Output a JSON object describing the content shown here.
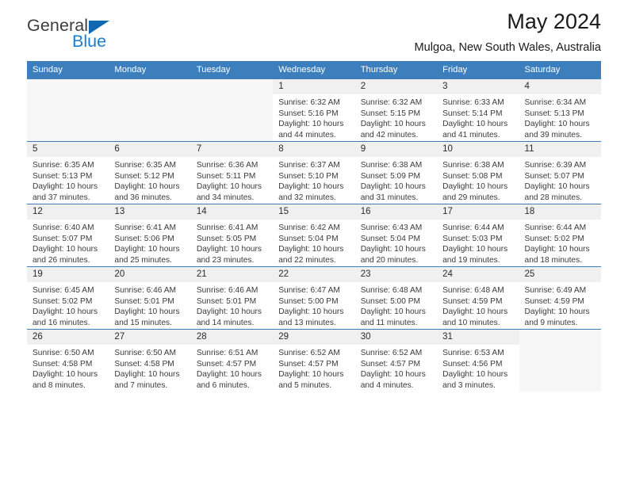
{
  "brand": {
    "name_part1": "General",
    "name_part2": "Blue",
    "triangle_color": "#1068b3",
    "blue_text_color": "#1b7dd1"
  },
  "header": {
    "title": "May 2024",
    "subtitle": "Mulgoa, New South Wales, Australia"
  },
  "theme": {
    "header_bg": "#3d7ebd",
    "header_text": "#ffffff",
    "daynum_bg": "#f0f0f0",
    "empty_cell_bg": "#f7f7f7"
  },
  "weekday_headers": [
    "Sunday",
    "Monday",
    "Tuesday",
    "Wednesday",
    "Thursday",
    "Friday",
    "Saturday"
  ],
  "weeks": [
    [
      {
        "empty": true
      },
      {
        "empty": true
      },
      {
        "empty": true
      },
      {
        "day": "1",
        "sunrise": "Sunrise: 6:32 AM",
        "sunset": "Sunset: 5:16 PM",
        "daylight1": "Daylight: 10 hours",
        "daylight2": "and 44 minutes."
      },
      {
        "day": "2",
        "sunrise": "Sunrise: 6:32 AM",
        "sunset": "Sunset: 5:15 PM",
        "daylight1": "Daylight: 10 hours",
        "daylight2": "and 42 minutes."
      },
      {
        "day": "3",
        "sunrise": "Sunrise: 6:33 AM",
        "sunset": "Sunset: 5:14 PM",
        "daylight1": "Daylight: 10 hours",
        "daylight2": "and 41 minutes."
      },
      {
        "day": "4",
        "sunrise": "Sunrise: 6:34 AM",
        "sunset": "Sunset: 5:13 PM",
        "daylight1": "Daylight: 10 hours",
        "daylight2": "and 39 minutes."
      }
    ],
    [
      {
        "day": "5",
        "sunrise": "Sunrise: 6:35 AM",
        "sunset": "Sunset: 5:13 PM",
        "daylight1": "Daylight: 10 hours",
        "daylight2": "and 37 minutes."
      },
      {
        "day": "6",
        "sunrise": "Sunrise: 6:35 AM",
        "sunset": "Sunset: 5:12 PM",
        "daylight1": "Daylight: 10 hours",
        "daylight2": "and 36 minutes."
      },
      {
        "day": "7",
        "sunrise": "Sunrise: 6:36 AM",
        "sunset": "Sunset: 5:11 PM",
        "daylight1": "Daylight: 10 hours",
        "daylight2": "and 34 minutes."
      },
      {
        "day": "8",
        "sunrise": "Sunrise: 6:37 AM",
        "sunset": "Sunset: 5:10 PM",
        "daylight1": "Daylight: 10 hours",
        "daylight2": "and 32 minutes."
      },
      {
        "day": "9",
        "sunrise": "Sunrise: 6:38 AM",
        "sunset": "Sunset: 5:09 PM",
        "daylight1": "Daylight: 10 hours",
        "daylight2": "and 31 minutes."
      },
      {
        "day": "10",
        "sunrise": "Sunrise: 6:38 AM",
        "sunset": "Sunset: 5:08 PM",
        "daylight1": "Daylight: 10 hours",
        "daylight2": "and 29 minutes."
      },
      {
        "day": "11",
        "sunrise": "Sunrise: 6:39 AM",
        "sunset": "Sunset: 5:07 PM",
        "daylight1": "Daylight: 10 hours",
        "daylight2": "and 28 minutes."
      }
    ],
    [
      {
        "day": "12",
        "sunrise": "Sunrise: 6:40 AM",
        "sunset": "Sunset: 5:07 PM",
        "daylight1": "Daylight: 10 hours",
        "daylight2": "and 26 minutes."
      },
      {
        "day": "13",
        "sunrise": "Sunrise: 6:41 AM",
        "sunset": "Sunset: 5:06 PM",
        "daylight1": "Daylight: 10 hours",
        "daylight2": "and 25 minutes."
      },
      {
        "day": "14",
        "sunrise": "Sunrise: 6:41 AM",
        "sunset": "Sunset: 5:05 PM",
        "daylight1": "Daylight: 10 hours",
        "daylight2": "and 23 minutes."
      },
      {
        "day": "15",
        "sunrise": "Sunrise: 6:42 AM",
        "sunset": "Sunset: 5:04 PM",
        "daylight1": "Daylight: 10 hours",
        "daylight2": "and 22 minutes."
      },
      {
        "day": "16",
        "sunrise": "Sunrise: 6:43 AM",
        "sunset": "Sunset: 5:04 PM",
        "daylight1": "Daylight: 10 hours",
        "daylight2": "and 20 minutes."
      },
      {
        "day": "17",
        "sunrise": "Sunrise: 6:44 AM",
        "sunset": "Sunset: 5:03 PM",
        "daylight1": "Daylight: 10 hours",
        "daylight2": "and 19 minutes."
      },
      {
        "day": "18",
        "sunrise": "Sunrise: 6:44 AM",
        "sunset": "Sunset: 5:02 PM",
        "daylight1": "Daylight: 10 hours",
        "daylight2": "and 18 minutes."
      }
    ],
    [
      {
        "day": "19",
        "sunrise": "Sunrise: 6:45 AM",
        "sunset": "Sunset: 5:02 PM",
        "daylight1": "Daylight: 10 hours",
        "daylight2": "and 16 minutes."
      },
      {
        "day": "20",
        "sunrise": "Sunrise: 6:46 AM",
        "sunset": "Sunset: 5:01 PM",
        "daylight1": "Daylight: 10 hours",
        "daylight2": "and 15 minutes."
      },
      {
        "day": "21",
        "sunrise": "Sunrise: 6:46 AM",
        "sunset": "Sunset: 5:01 PM",
        "daylight1": "Daylight: 10 hours",
        "daylight2": "and 14 minutes."
      },
      {
        "day": "22",
        "sunrise": "Sunrise: 6:47 AM",
        "sunset": "Sunset: 5:00 PM",
        "daylight1": "Daylight: 10 hours",
        "daylight2": "and 13 minutes."
      },
      {
        "day": "23",
        "sunrise": "Sunrise: 6:48 AM",
        "sunset": "Sunset: 5:00 PM",
        "daylight1": "Daylight: 10 hours",
        "daylight2": "and 11 minutes."
      },
      {
        "day": "24",
        "sunrise": "Sunrise: 6:48 AM",
        "sunset": "Sunset: 4:59 PM",
        "daylight1": "Daylight: 10 hours",
        "daylight2": "and 10 minutes."
      },
      {
        "day": "25",
        "sunrise": "Sunrise: 6:49 AM",
        "sunset": "Sunset: 4:59 PM",
        "daylight1": "Daylight: 10 hours",
        "daylight2": "and 9 minutes."
      }
    ],
    [
      {
        "day": "26",
        "sunrise": "Sunrise: 6:50 AM",
        "sunset": "Sunset: 4:58 PM",
        "daylight1": "Daylight: 10 hours",
        "daylight2": "and 8 minutes."
      },
      {
        "day": "27",
        "sunrise": "Sunrise: 6:50 AM",
        "sunset": "Sunset: 4:58 PM",
        "daylight1": "Daylight: 10 hours",
        "daylight2": "and 7 minutes."
      },
      {
        "day": "28",
        "sunrise": "Sunrise: 6:51 AM",
        "sunset": "Sunset: 4:57 PM",
        "daylight1": "Daylight: 10 hours",
        "daylight2": "and 6 minutes."
      },
      {
        "day": "29",
        "sunrise": "Sunrise: 6:52 AM",
        "sunset": "Sunset: 4:57 PM",
        "daylight1": "Daylight: 10 hours",
        "daylight2": "and 5 minutes."
      },
      {
        "day": "30",
        "sunrise": "Sunrise: 6:52 AM",
        "sunset": "Sunset: 4:57 PM",
        "daylight1": "Daylight: 10 hours",
        "daylight2": "and 4 minutes."
      },
      {
        "day": "31",
        "sunrise": "Sunrise: 6:53 AM",
        "sunset": "Sunset: 4:56 PM",
        "daylight1": "Daylight: 10 hours",
        "daylight2": "and 3 minutes."
      },
      {
        "empty": true
      }
    ]
  ]
}
